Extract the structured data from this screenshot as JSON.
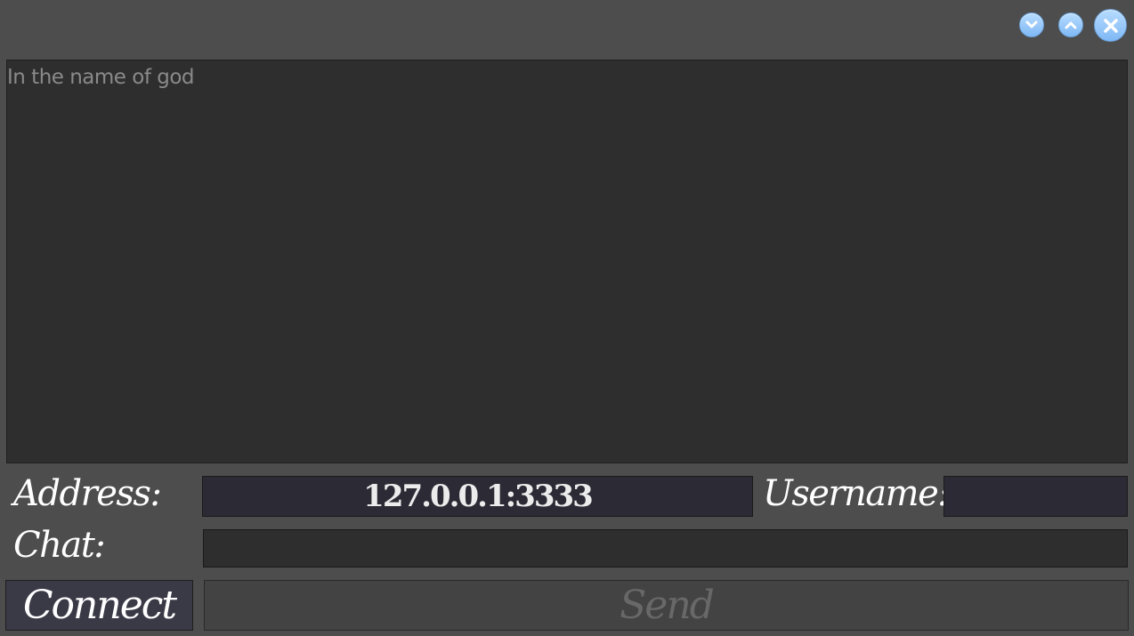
{
  "window": {
    "minimize_icon": "chevron-down-icon",
    "maximize_icon": "chevron-up-icon",
    "close_icon": "close-icon",
    "button_color": "#9fcbfa"
  },
  "log": {
    "text": "In the name of god"
  },
  "form": {
    "address_label": "Address:",
    "address_value": "127.0.0.1:3333",
    "username_label": "Username:",
    "username_value": "",
    "chat_label": "Chat:",
    "chat_value": ""
  },
  "buttons": {
    "connect": "Connect",
    "send": "Send"
  },
  "colors": {
    "background": "#4d4d4d",
    "panel": "#2e2e2e",
    "input": "#2c2b35",
    "text": "#ffffff",
    "muted_text": "#8a8a8a",
    "disabled_text": "#686868"
  }
}
